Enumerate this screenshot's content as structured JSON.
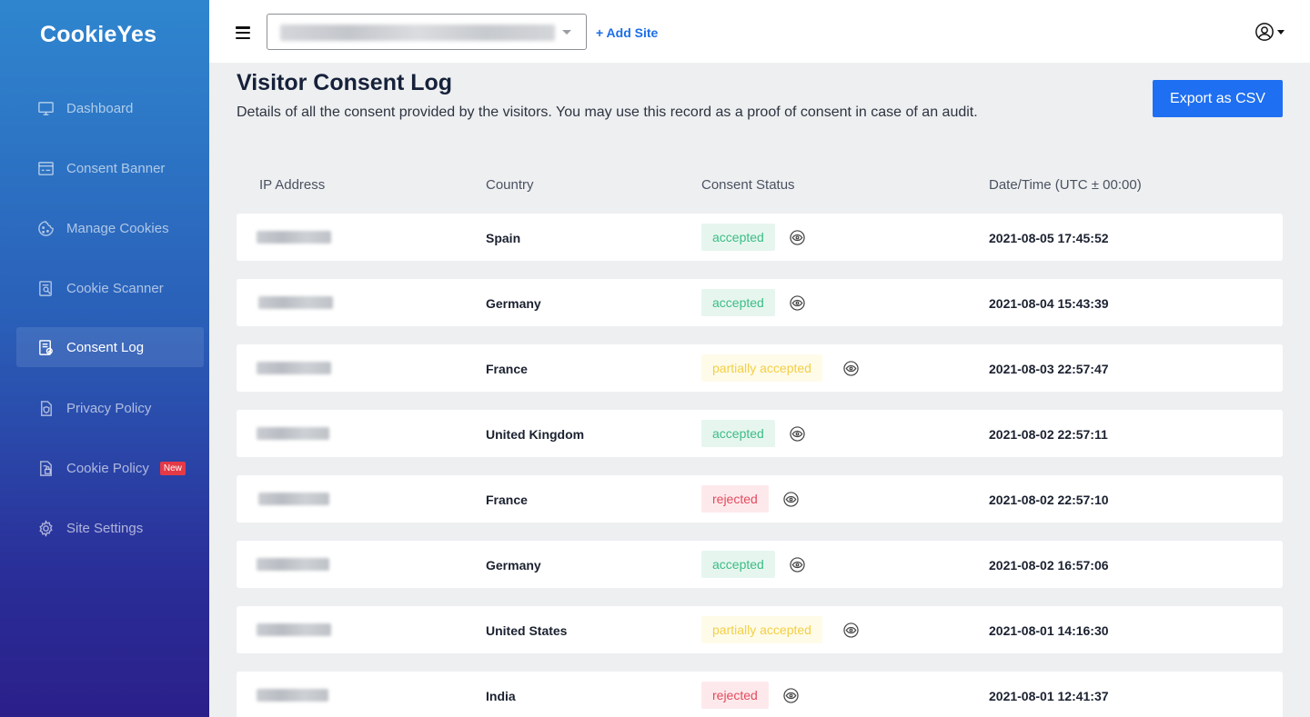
{
  "app": {
    "logo_text": "CookieYes"
  },
  "sidebar": {
    "items": [
      {
        "label": "Dashboard",
        "icon": "monitor-icon",
        "active": false
      },
      {
        "label": "Consent Banner",
        "icon": "banner-icon",
        "active": false
      },
      {
        "label": "Manage Cookies",
        "icon": "cookie-icon",
        "active": false
      },
      {
        "label": "Cookie Scanner",
        "icon": "scanner-icon",
        "active": false
      },
      {
        "label": "Consent Log",
        "icon": "consent-log-icon",
        "active": true
      },
      {
        "label": "Privacy Policy",
        "icon": "privacy-policy-icon",
        "active": false
      },
      {
        "label": "Cookie Policy",
        "icon": "cookie-policy-icon",
        "active": false,
        "badge": "New"
      },
      {
        "label": "Site Settings",
        "icon": "gear-icon",
        "active": false
      }
    ]
  },
  "topbar": {
    "add_site_label": "+ Add Site"
  },
  "main": {
    "title": "Visitor Consent Log",
    "description": "Details of all the consent provided by the visitors. You may use this record as a proof of consent in case of an audit.",
    "export_label": "Export as CSV",
    "columns": [
      "IP Address",
      "Country",
      "Consent Status",
      "Date/Time (UTC ± 00:00)"
    ],
    "rows": [
      {
        "country": "Spain",
        "status": "accepted",
        "datetime": "2021-08-05 17:45:52"
      },
      {
        "country": "Germany",
        "status": "accepted",
        "datetime": "2021-08-04 15:43:39"
      },
      {
        "country": "France",
        "status": "partially accepted",
        "datetime": "2021-08-03 22:57:47"
      },
      {
        "country": "United Kingdom",
        "status": "accepted",
        "datetime": "2021-08-02 22:57:11"
      },
      {
        "country": "France",
        "status": "rejected",
        "datetime": "2021-08-02 22:57:10"
      },
      {
        "country": "Germany",
        "status": "accepted",
        "datetime": "2021-08-02 16:57:06"
      },
      {
        "country": "United States",
        "status": "partially accepted",
        "datetime": "2021-08-01 14:16:30"
      },
      {
        "country": "India",
        "status": "rejected",
        "datetime": "2021-08-01 12:41:37"
      }
    ]
  },
  "colors": {
    "accent": "#1e6ff1",
    "accepted": "#3dbc85",
    "partially_accepted": "#f3cf45",
    "rejected": "#e24b5c",
    "new_badge": "#e53946"
  }
}
